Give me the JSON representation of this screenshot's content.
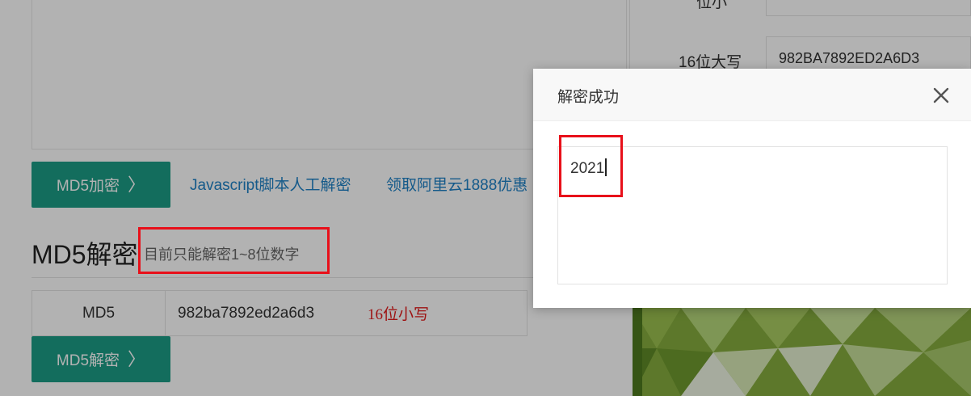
{
  "encrypt": {
    "button_label": "MD5加密",
    "links": [
      "Javascript脚本人工解密",
      "领取阿里云1888优惠"
    ]
  },
  "decrypt": {
    "title": "MD5解密",
    "hint": "目前只能解密1~8位数字",
    "row_label": "MD5",
    "row_value": "982ba7892ed2a6d3",
    "note": "16位小写",
    "button_label": "MD5解密"
  },
  "right_panel": {
    "partial_label": "位小",
    "upper16_label": "16位大写",
    "upper16_value": "982BA7892ED2A6D3"
  },
  "modal": {
    "title": "解密成功",
    "result": "2021",
    "close_icon": "close-icon"
  },
  "colors": {
    "teal": "#1c9c86",
    "link": "#1f82c6",
    "highlight_red": "#e8101a",
    "note_red": "#e21b1b"
  }
}
